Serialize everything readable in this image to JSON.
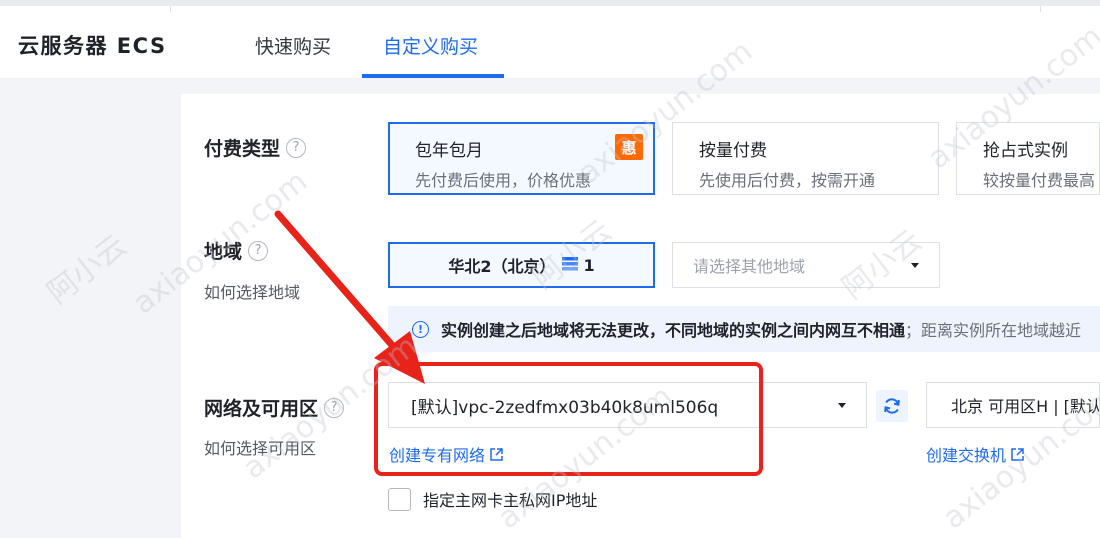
{
  "header": {
    "brand": "云服务器 ECS",
    "tabs": [
      {
        "label": "快速购买",
        "active": false
      },
      {
        "label": "自定义购买",
        "active": true
      }
    ]
  },
  "billing": {
    "label": "付费类型",
    "help": "?",
    "cards": [
      {
        "title": "包年包月",
        "desc": "先付费后使用，价格优惠",
        "badge": "惠",
        "selected": true
      },
      {
        "title": "按量付费",
        "desc": "先使用后付费，按需开通",
        "selected": false
      },
      {
        "title": "抢占式实例",
        "desc": "较按量付费最高",
        "selected": false
      }
    ]
  },
  "region": {
    "label": "地域",
    "help": "?",
    "sublink": "如何选择地域",
    "selected": {
      "name": "华北2（北京）",
      "count": "1"
    },
    "other_placeholder": "请选择其他地域",
    "notice": {
      "main": "实例创建之后地域将无法更改，不同地域的实例之间内网互不相通",
      "rest": "；距离实例所在地域越近"
    }
  },
  "network": {
    "label": "网络及可用区",
    "help": "?",
    "sublink": "如何选择可用区",
    "vpc_value": "[默认]vpc-2zedfmx03b40k8uml506q",
    "create_vpc_link": "创建专有网络",
    "zone_value": "北京 可用区H | [默认",
    "create_vswitch_link": "创建交换机",
    "checkbox_label": "指定主网卡主私网IP地址",
    "checkbox_checked": false
  },
  "watermark": {
    "text1": "axiaoyun.com",
    "text2": "阿小云"
  },
  "colors": {
    "primary": "#1d6cf0",
    "badge": "#ff6a00",
    "annotation": "#e8231a"
  },
  "icons": [
    "help-circle-icon",
    "server-icon",
    "chevron-down-icon",
    "info-icon",
    "refresh-icon",
    "external-link-icon",
    "red-arrow-icon"
  ]
}
